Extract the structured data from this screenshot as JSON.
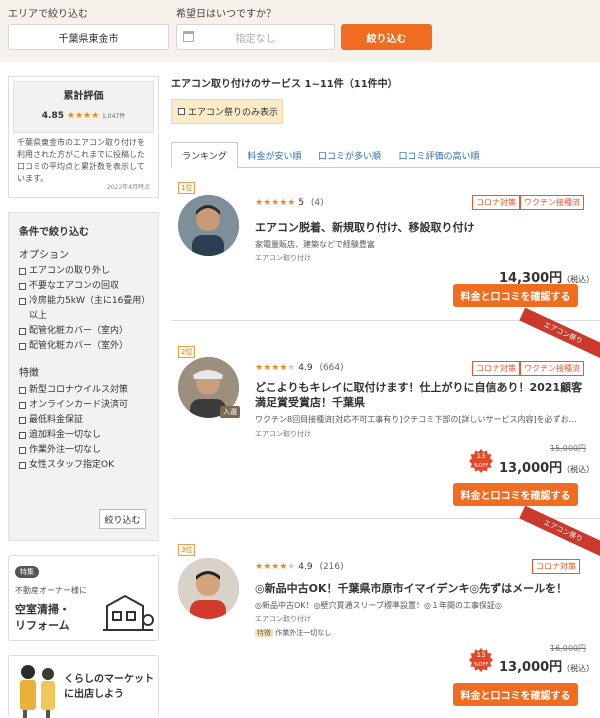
{
  "search": {
    "area_label": "エリアで絞り込む",
    "area_value": "千葉県東金市",
    "date_label": "希望日はいつですか？",
    "date_placeholder": "指定なし",
    "filter_button": "絞り込む"
  },
  "rating_panel": {
    "title": "累計評価",
    "score": "4.85",
    "stars": "★★★★",
    "count": "1,047件",
    "description": "千葉県東金市のエアコン取り付けを利用された方がこれまでに投稿した口コミの平均点と累計数を表示しています。",
    "date": "2022年4月時点"
  },
  "filter_panel": {
    "title": "条件で絞り込む",
    "options_title": "オプション",
    "options": [
      "エアコンの取り外し",
      "不要なエアコンの回収",
      "冷房能力5kW（主に16畳用）以上",
      "配管化粧カバー（室内）",
      "配管化粧カバー（室外）"
    ],
    "features_title": "特徴",
    "features": [
      "新型コロナウイルス対策",
      "オンラインカード決済可",
      "最低料金保証",
      "追加料金一切なし",
      "作業外注一切なし",
      "女性スタッフ指定OK"
    ],
    "apply_button": "絞り込む"
  },
  "promo1": {
    "tag": "特集",
    "line1": "不動産オーナー様に",
    "line2": "空室清掃・",
    "line3": "リフォーム"
  },
  "promo2": {
    "line1": "くらしのマーケット",
    "line2": "に出店しよう"
  },
  "main": {
    "heading": "エアコン取り付けのサービス 1~11件（11件中）",
    "festival_filter": "エアコン祭りのみ表示",
    "tabs": [
      "ランキング",
      "料金が安い順",
      "口コミが多い順",
      "口コミ評価の高い順"
    ],
    "items": [
      {
        "rank": "1位",
        "stars": "★★★★★",
        "score": "5",
        "reviews": "(4)",
        "badges": [
          "コロナ対策",
          "ワクチン接種済"
        ],
        "title": "エアコン脱着、新規取り付け、移設取り付け",
        "desc": "家電量販店、建築などで経験豊富",
        "category": "エアコン取り付け",
        "price": "14,300円",
        "tax": "（税込）",
        "cta": "料金と口コミを確認する"
      },
      {
        "rank": "2位",
        "stars": "★★★★",
        "score": "4.9",
        "reviews": "(664)",
        "badges": [
          "コロナ対策",
          "ワクチン接種済"
        ],
        "ribbon": "エアコン祭り",
        "avatar_tag": "入選",
        "title": "どこよりもキレイに取付けます！仕上がりに自信あり！2021顧客満足賞受賞店！千葉県",
        "desc": "ワクチン8回目接種済[対応不可工事有り]クチコミ下部の[詳しいサービス内容]を必ずお…",
        "category": "エアコン取り付け",
        "old_price": "15,000円",
        "discount": "13",
        "discount_unit": "%OFF",
        "price": "13,000円",
        "tax": "（税込）",
        "cta": "料金と口コミを確認する"
      },
      {
        "rank": "3位",
        "stars": "★★★★",
        "score": "4.9",
        "reviews": "(216)",
        "badges": [
          "コロナ対策"
        ],
        "ribbon": "エアコン祭り",
        "title": "◎新品中古OK！千葉県市原市イマイデンキ◎先ずはメールを！",
        "desc": "◎新品中古OK！◎壁穴貫通スリーブ標準設置！◎１年間の工事保証◎",
        "category": "エアコン取り付け",
        "feature_tag": "特徴",
        "feature_text": "作業外注一切なし",
        "old_price": "16,000円",
        "discount": "13",
        "discount_unit": "%OFF",
        "price": "13,000円",
        "tax": "（税込）",
        "cta": "料金と口コミを確認する"
      }
    ]
  },
  "colors": {
    "accent": "#ef6c21",
    "header_bg": "#f6f1ea",
    "star": "#f08a24",
    "link": "#2e6fb0"
  }
}
